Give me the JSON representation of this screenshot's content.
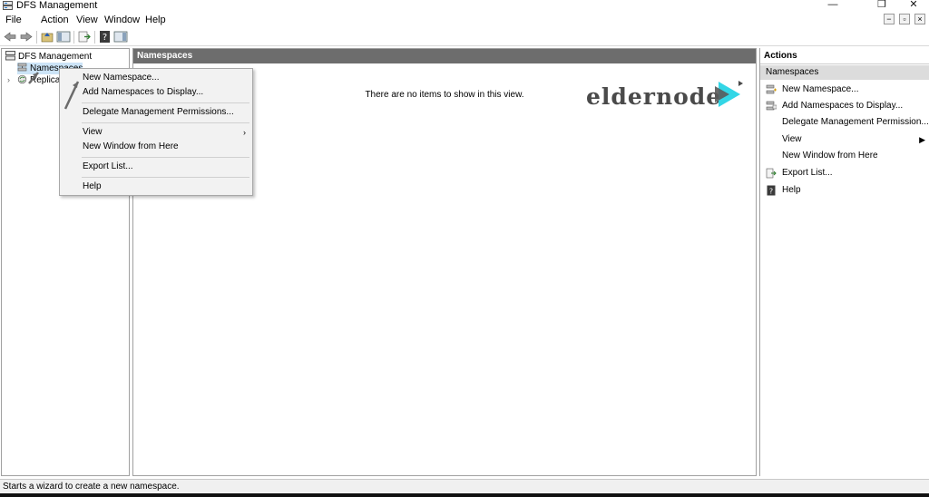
{
  "window": {
    "title": "DFS Management",
    "minimize": "—",
    "restore": "❐",
    "close": "✕"
  },
  "menubar": {
    "items": [
      "File",
      "Action",
      "View",
      "Window",
      "Help"
    ],
    "child_minimize": "−",
    "child_restore": "▫",
    "child_close": "×"
  },
  "toolbar": {
    "buttons": [
      "back-icon",
      "forward-icon",
      "up-folder-icon",
      "show-hide-tree-icon",
      "export-icon",
      "help-icon",
      "show-action-pane-icon"
    ]
  },
  "tree": {
    "root": "DFS Management",
    "items": [
      {
        "label": "Namespaces",
        "icon": "namespaces-icon"
      },
      {
        "label": "Replication",
        "icon": "replication-icon",
        "expander": "›"
      }
    ]
  },
  "center": {
    "header": "Namespaces",
    "empty_message": "There are no items to show in this view."
  },
  "context_menu": {
    "items": [
      {
        "label": "New Namespace..."
      },
      {
        "label": "Add Namespaces to Display..."
      },
      {
        "label": "Delegate Management Permissions..."
      },
      {
        "label": "View",
        "submenu": "›"
      },
      {
        "label": "New Window from Here"
      },
      {
        "label": "Export List..."
      },
      {
        "label": "Help"
      }
    ]
  },
  "actions": {
    "title": "Actions",
    "section": "Namespaces",
    "items": [
      {
        "label": "New Namespace...",
        "icon": "new-namespace-icon"
      },
      {
        "label": "Add Namespaces to Display...",
        "icon": "add-namespaces-icon"
      },
      {
        "label": "Delegate Management Permission...",
        "icon": ""
      },
      {
        "label": "View",
        "icon": "",
        "arrow": "▶"
      },
      {
        "label": "New Window from Here",
        "icon": ""
      },
      {
        "label": "Export List...",
        "icon": "export-list-icon"
      },
      {
        "label": "Help",
        "icon": "help-icon"
      }
    ]
  },
  "watermark": {
    "text": "eldernode",
    "colors": {
      "text": "#4a4a4a",
      "accent": "#33d6e6"
    }
  },
  "statusbar": {
    "text": "Starts a wizard to create a new namespace."
  },
  "colors": {
    "pane_header": "#6d6d6d",
    "actions_section": "#dcdcdc",
    "menu_background": "#f2f2f2"
  }
}
